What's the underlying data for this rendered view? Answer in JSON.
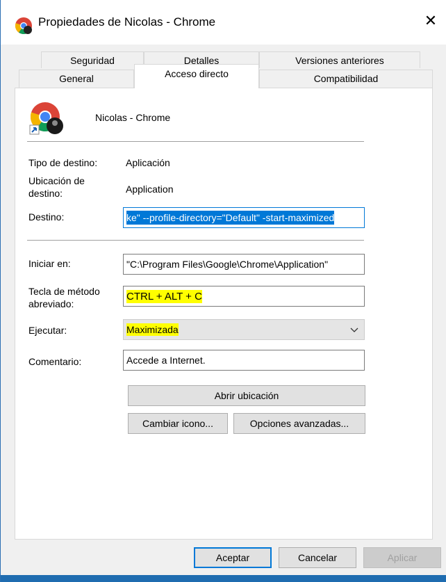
{
  "window": {
    "title": "Propiedades de Nicolas - Chrome",
    "close_glyph": "✕"
  },
  "tabs": {
    "row1": [
      "Seguridad",
      "Detalles",
      "Versiones anteriores"
    ],
    "row2": [
      "General",
      "Acceso directo",
      "Compatibilidad"
    ],
    "active": "Acceso directo"
  },
  "shortcut": {
    "name": "Nicolas - Chrome",
    "target_type_label": "Tipo de destino:",
    "target_type_value": "Aplicación",
    "target_location_label_1": "Ubicación de",
    "target_location_label_2": "destino:",
    "target_location_value": "Application",
    "target_label": "Destino:",
    "target_value": "ke\" --profile-directory=\"Default\" -start-maximized",
    "start_in_label": "Iniciar en:",
    "start_in_value": "\"C:\\Program Files\\Google\\Chrome\\Application\"",
    "hotkey_label_1": "Tecla de método",
    "hotkey_label_2": "abreviado:",
    "hotkey_value": "CTRL + ALT + C",
    "run_label": "Ejecutar:",
    "run_value": "Maximizada",
    "comment_label": "Comentario:",
    "comment_value": "Accede a Internet."
  },
  "buttons": {
    "open_location": "Abrir ubicación",
    "change_icon": "Cambiar icono...",
    "advanced": "Opciones avanzadas...",
    "ok": "Aceptar",
    "cancel": "Cancelar",
    "apply": "Aplicar"
  },
  "colors": {
    "selection": "#0078d7",
    "highlight": "#ffff00"
  }
}
